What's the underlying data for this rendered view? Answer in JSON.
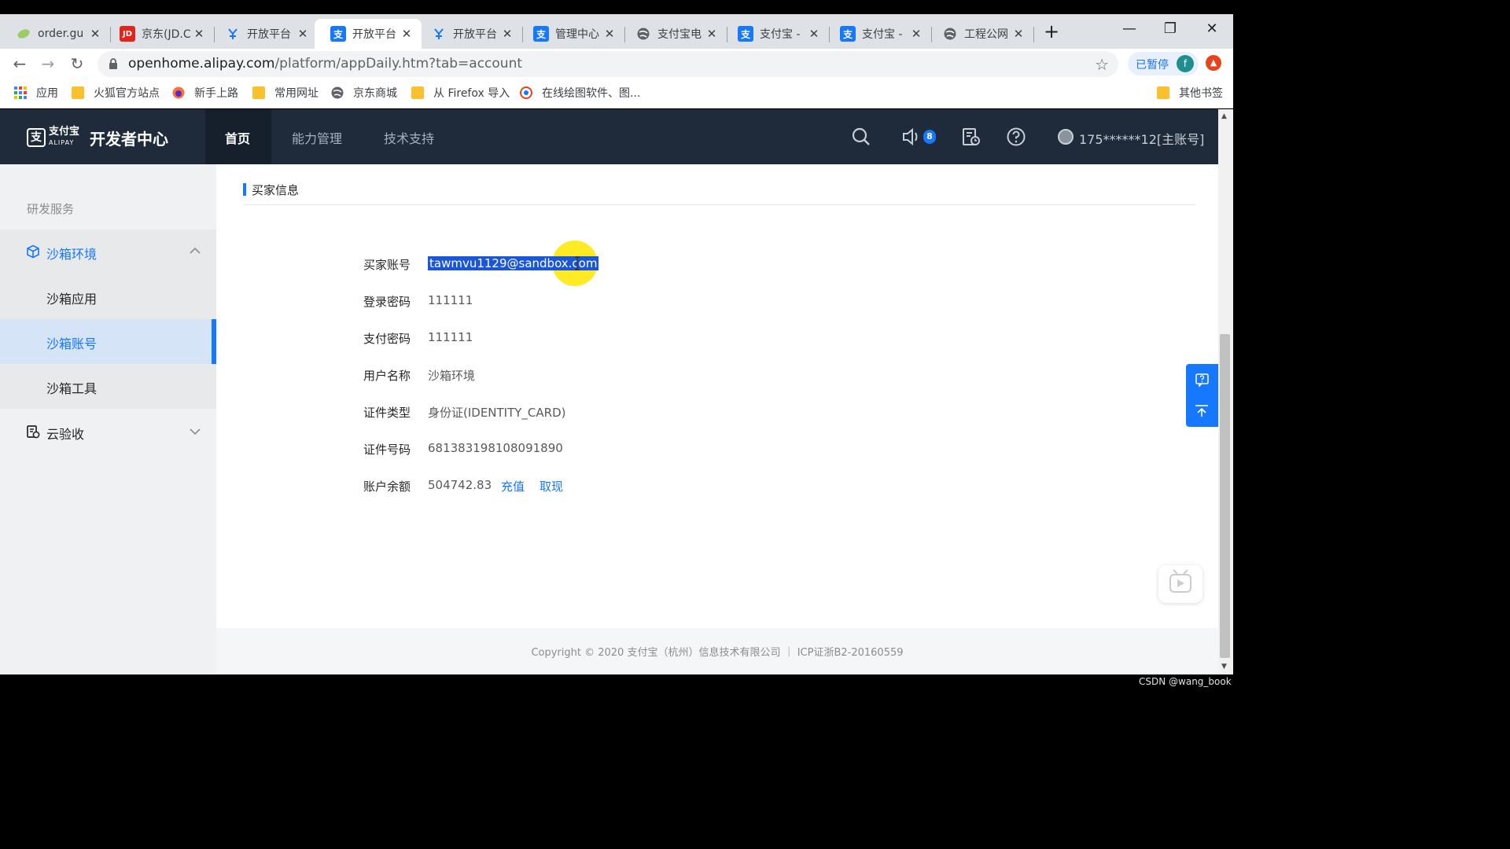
{
  "browser": {
    "tabs": [
      {
        "title": "order.gu",
        "icon": "leaf-icon",
        "color": "#7cb342"
      },
      {
        "title": "京东(JD.C",
        "icon": "jd-icon",
        "color": "#e1251b"
      },
      {
        "title": "开放平台",
        "icon": "open-platform-icon",
        "color": "#1677ff"
      },
      {
        "title": "开放平台",
        "icon": "alipay-icon",
        "color": "#1677ff"
      },
      {
        "title": "开放平台",
        "icon": "open-platform-icon",
        "color": "#1677ff"
      },
      {
        "title": "管理中心",
        "icon": "alipay-icon",
        "color": "#1677ff"
      },
      {
        "title": "支付宝电",
        "icon": "globe-icon",
        "color": "#5f6368"
      },
      {
        "title": "支付宝 -",
        "icon": "alipay-icon",
        "color": "#1677ff"
      },
      {
        "title": "支付宝 -",
        "icon": "alipay-icon",
        "color": "#1677ff"
      },
      {
        "title": "工程公网",
        "icon": "globe-icon",
        "color": "#5f6368"
      }
    ],
    "active_tab_index": 3,
    "close_glyph": "✕",
    "new_tab_glyph": "+",
    "url_host": "openhome.alipay.com",
    "url_path": "/platform/appDaily.htm?tab=account",
    "paused_label": "已暂停",
    "profile_initial": "f",
    "bookmarks": [
      {
        "label": "应用",
        "icon": "apps-grid-icon"
      },
      {
        "label": "火狐官方站点",
        "icon": "folder-icon"
      },
      {
        "label": "新手上路",
        "icon": "firefox-icon"
      },
      {
        "label": "常用网址",
        "icon": "folder-icon"
      },
      {
        "label": "京东商城",
        "icon": "globe-icon"
      },
      {
        "label": "从 Firefox 导入",
        "icon": "folder-icon"
      },
      {
        "label": "在线绘图软件、图...",
        "icon": "draw-tool-icon"
      },
      {
        "label": "其他书签",
        "icon": "folder-icon"
      }
    ]
  },
  "header": {
    "logo_cn": "支付宝",
    "logo_en": "ALIPAY",
    "site_title": "开发者中心",
    "nav": [
      "首页",
      "能力管理",
      "技术支持"
    ],
    "notification_count": "8",
    "account": "175******12[主账号]"
  },
  "sidebar": {
    "heading": "研发服务",
    "groups": [
      {
        "label": "沙箱环境",
        "expanded": true,
        "children": [
          "沙箱应用",
          "沙箱账号",
          "沙箱工具"
        ],
        "selected_child": "沙箱账号"
      },
      {
        "label": "云验收",
        "expanded": false
      }
    ]
  },
  "main": {
    "section_title": "买家信息",
    "fields": [
      {
        "key": "买家账号",
        "value": "tawmvu1129@sandbox.com"
      },
      {
        "key": "登录密码",
        "value": "111111"
      },
      {
        "key": "支付密码",
        "value": "111111"
      },
      {
        "key": "用户名称",
        "value": "沙箱环境"
      },
      {
        "key": "证件类型",
        "value": "身份证(IDENTITY_CARD)"
      },
      {
        "key": "证件号码",
        "value": "681383198108091890"
      },
      {
        "key": "账户余额",
        "value": "504742.83"
      }
    ],
    "balance_actions": [
      "充值",
      "取现"
    ]
  },
  "footer": {
    "copyright": "Copyright © 2020 支付宝（杭州）信息技术有限公司 ｜ ICP证浙B2-20160559"
  },
  "watermark": "CSDN @wang_book",
  "colors": {
    "accent": "#1677ff",
    "nav_bg": "#1f2a3a",
    "highlight": "#ffe600"
  }
}
